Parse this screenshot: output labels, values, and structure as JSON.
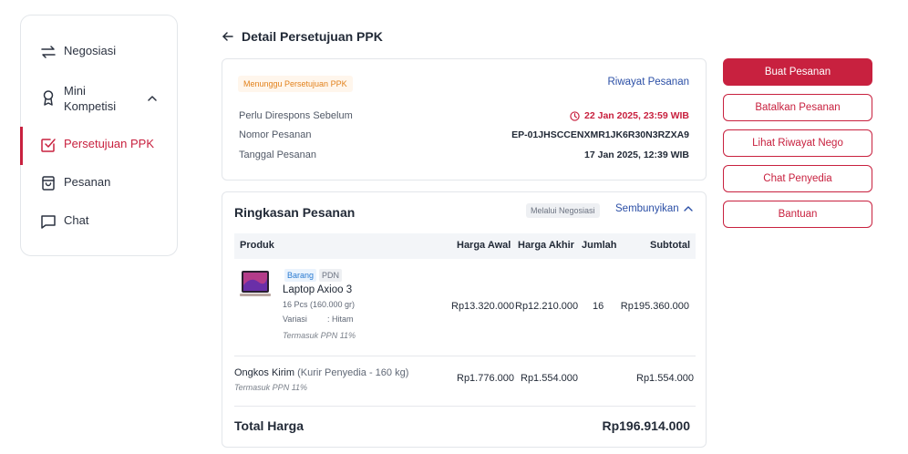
{
  "sidebar": {
    "items": [
      {
        "label": "Negosiasi"
      },
      {
        "label": "Mini Kompetisi"
      },
      {
        "label": "Persetujuan PPK"
      },
      {
        "label": "Pesanan"
      },
      {
        "label": "Chat"
      }
    ]
  },
  "header": {
    "title": "Detail Persetujuan PPK"
  },
  "status_card": {
    "badge": "Menunggu Persetujuan PPK",
    "history_link": "Riwayat Pesanan",
    "rows": [
      {
        "key": "Perlu Direspons Sebelum",
        "value": "22 Jan 2025, 23:59 WIB"
      },
      {
        "key": "Nomor Pesanan",
        "value": "EP-01JHSCCENXMR1JK6R30N3RZXA9"
      },
      {
        "key": "Tanggal Pesanan",
        "value": "17 Jan 2025, 12:39 WIB"
      }
    ]
  },
  "summary": {
    "title": "Ringkasan Pesanan",
    "via_tag": "Melalui Negosiasi",
    "hide_link": "Sembunyikan",
    "columns": [
      "Produk",
      "Harga Awal",
      "Harga Akhir",
      "Jumlah",
      "Subtotal"
    ],
    "product": {
      "tag_type": "Barang",
      "tag_origin": "PDN",
      "name": "Laptop Axioo 3",
      "qty_desc": "16 Pcs (160.000 gr)",
      "variant_label": "Variasi",
      "variant_value": ": Hitam",
      "tax_note": "Termasuk PPN 11%",
      "price_initial": "Rp13.320.000",
      "price_final": "Rp12.210.000",
      "quantity": "16",
      "subtotal": "Rp195.360.000"
    },
    "shipping": {
      "label": "Ongkos Kirim",
      "detail": "(Kurir Penyedia - 160 kg)",
      "tax_note": "Termasuk PPN 11%",
      "price_initial": "Rp1.776.000",
      "price_final": "Rp1.554.000",
      "subtotal": "Rp1.554.000"
    },
    "total_label": "Total Harga",
    "total_value": "Rp196.914.000"
  },
  "actions": {
    "create_order": "Buat Pesanan",
    "cancel_order": "Batalkan Pesanan",
    "nego_history": "Lihat Riwayat Nego",
    "chat_vendor": "Chat Penyedia",
    "help": "Bantuan"
  },
  "colors": {
    "accent": "#c8213f",
    "link": "#2b4fa6",
    "warning": "#e2811b"
  }
}
